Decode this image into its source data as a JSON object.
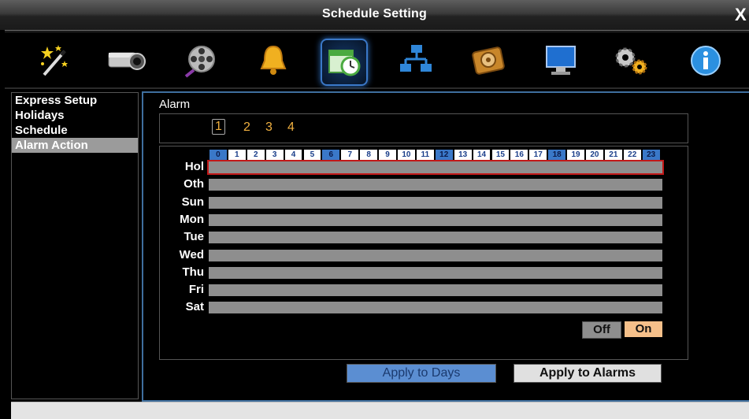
{
  "window": {
    "title": "Schedule Setting",
    "close_glyph": "X"
  },
  "toolbar": {
    "icons": [
      {
        "name": "wizard-icon"
      },
      {
        "name": "camera-icon"
      },
      {
        "name": "film-reel-icon"
      },
      {
        "name": "alarm-bell-icon"
      },
      {
        "name": "schedule-clock-icon",
        "selected": true
      },
      {
        "name": "network-icon"
      },
      {
        "name": "hard-disk-icon"
      },
      {
        "name": "monitor-icon"
      },
      {
        "name": "system-gears-icon"
      },
      {
        "name": "info-icon"
      }
    ]
  },
  "sidebar": {
    "items": [
      {
        "label": "Express Setup"
      },
      {
        "label": "Holidays"
      },
      {
        "label": "Schedule"
      },
      {
        "label": "Alarm Action",
        "active": true
      }
    ]
  },
  "main": {
    "alarm_label": "Alarm",
    "alarm_numbers": [
      "1",
      "2",
      "3",
      "4"
    ],
    "selected_alarm": "1",
    "hours": [
      "0",
      "1",
      "2",
      "3",
      "4",
      "5",
      "6",
      "7",
      "8",
      "9",
      "10",
      "11",
      "12",
      "13",
      "14",
      "15",
      "16",
      "17",
      "18",
      "19",
      "20",
      "21",
      "22",
      "23"
    ],
    "highlight_hours": [
      "0",
      "6",
      "12",
      "18",
      "23"
    ],
    "days": [
      "Hol",
      "Oth",
      "Sun",
      "Mon",
      "Tue",
      "Wed",
      "Thu",
      "Fri",
      "Sat"
    ],
    "selected_day": "Hol",
    "legend": {
      "off": "Off",
      "on": "On",
      "off_color": "#8e8e8e",
      "on_color": "#f6c08a"
    },
    "buttons": {
      "apply_days": "Apply to Days",
      "apply_alarms": "Apply to Alarms"
    }
  },
  "colors": {
    "accent": "#3a78c8",
    "selection_outline": "#c21818"
  }
}
